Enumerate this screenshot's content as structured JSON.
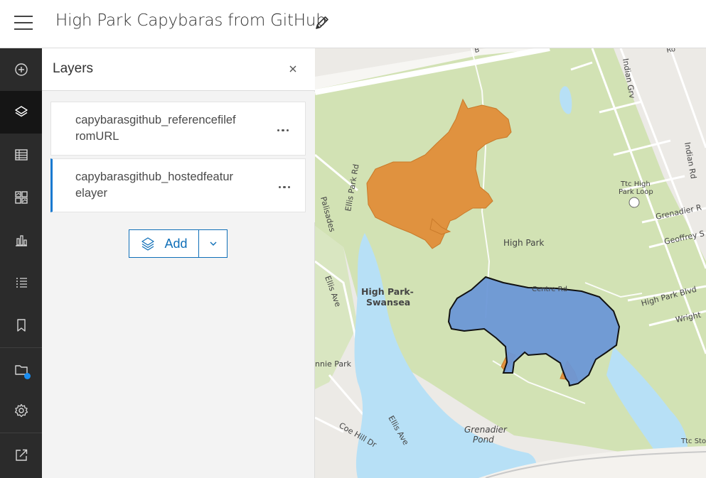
{
  "header": {
    "title": "High Park Capybaras from GitHub",
    "menu_icon": "hamburger-menu-icon",
    "edit_icon": "pencil-icon"
  },
  "action_bar": {
    "items": [
      {
        "name": "add",
        "icon": "plus-circle-icon"
      },
      {
        "name": "layers",
        "icon": "layers-icon",
        "active": true
      },
      {
        "name": "tables",
        "icon": "table-icon"
      },
      {
        "name": "basemap",
        "icon": "basemap-gallery-icon"
      },
      {
        "name": "charts",
        "icon": "bar-chart-icon"
      },
      {
        "name": "legend",
        "icon": "legend-list-icon"
      },
      {
        "name": "bookmarks",
        "icon": "bookmark-icon"
      },
      {
        "name": "save",
        "icon": "folder-icon",
        "badge": true
      },
      {
        "name": "settings",
        "icon": "gear-icon"
      },
      {
        "name": "share",
        "icon": "share-icon"
      }
    ]
  },
  "panel": {
    "title": "Layers",
    "close_icon": "close-icon",
    "layers": [
      {
        "name": "capybarasgithub_referencefilefromURL",
        "selected": false
      },
      {
        "name": "capybarasgithub_hostedfeaturelayer",
        "selected": true
      }
    ],
    "add_label": "Add",
    "add_dropdown_icon": "chevron-down-icon"
  },
  "map": {
    "labels": {
      "high_park": "High Park",
      "high_park_swansea_1": "High Park-",
      "high_park_swansea_2": "Swansea",
      "ellis_park_rd": "Ellis Park Rd",
      "ellis_ave": "Ellis Ave",
      "ellis_ave_2": "Ellis Ave",
      "palisades": "Palisades",
      "indian_grv": "Indian Grv",
      "indian_rd": "Indian Rd",
      "ttc_high_park_loop_1": "Ttc High",
      "ttc_high_park_loop_2": "Park Loop",
      "grenadier_rd": "Grenadier R",
      "geoffrey": "Geoffrey S",
      "high_park_blvd": "High Park Blvd",
      "wright": "Wright",
      "centre_rd": "Centre Rd",
      "ennie_park": "nnie Park",
      "coe_hill_dr": "Coe Hill Dr",
      "grenadier_pond_1": "Grenadier",
      "grenadier_pond_2": "Pond",
      "ttc_stop": "Ttc Stop",
      "top_road_1": "B",
      "top_road_2": "Ro"
    },
    "colors": {
      "park": "#d2e2b4",
      "water": "#b7e0f6",
      "land": "#eceae6",
      "orange_capybara": "#e0923f",
      "blue_capybara": "#6b97d6"
    }
  }
}
